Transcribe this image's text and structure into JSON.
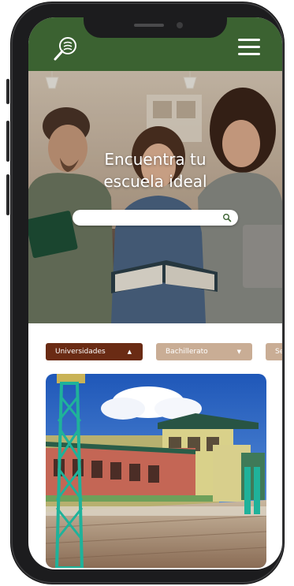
{
  "hero": {
    "title_line1": "Encuentra tu",
    "title_line2": "escuela ideal"
  },
  "search": {
    "placeholder": "",
    "value": ""
  },
  "filters": [
    {
      "label": "Universidades",
      "caret": "▲",
      "active": true
    },
    {
      "label": "Bachillerato",
      "caret": "▼",
      "active": false
    },
    {
      "label": "Se",
      "caret": "",
      "active": false
    }
  ],
  "colors": {
    "header": "#3b6231",
    "filter_active": "#6a2b14",
    "filter_inactive": "#c9ad95"
  },
  "icons": {
    "logo": "search-book-logo-icon",
    "menu": "hamburger-menu-icon",
    "search": "search-icon"
  }
}
